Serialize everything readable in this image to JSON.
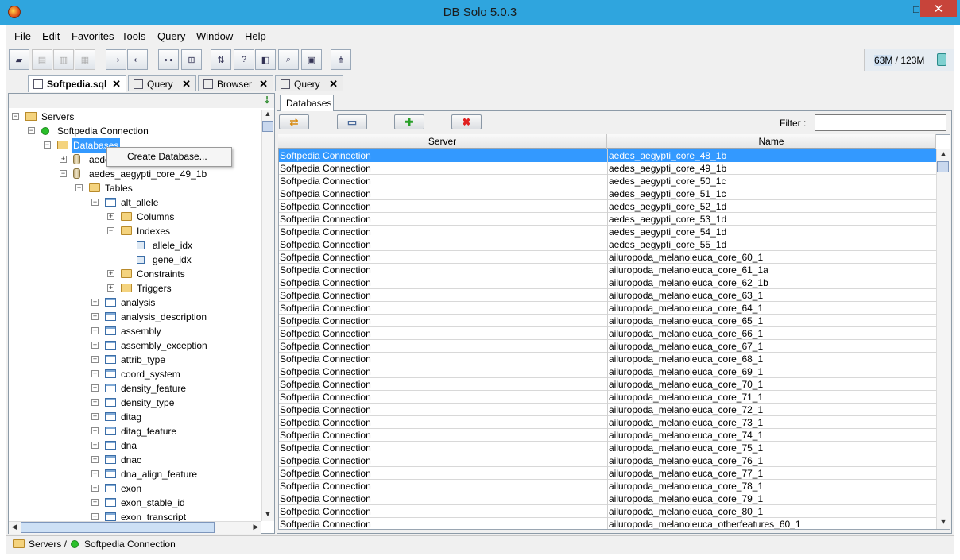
{
  "window": {
    "title": "DB Solo  5.0.3",
    "minimize": "–",
    "maximize": "□",
    "close": "✕"
  },
  "menu": [
    {
      "pre": "",
      "u": "F",
      "post": "ile"
    },
    {
      "pre": "",
      "u": "E",
      "post": "dit"
    },
    {
      "pre": "F",
      "u": "a",
      "post": "vorites"
    },
    {
      "pre": "",
      "u": "T",
      "post": "ools"
    },
    {
      "pre": "",
      "u": "Q",
      "post": "uery"
    },
    {
      "pre": "",
      "u": "W",
      "post": "indow"
    },
    {
      "pre": "",
      "u": "H",
      "post": "elp"
    }
  ],
  "toolbar": {
    "buttons": [
      "open-icon",
      "save-all-icon",
      "save-icon",
      "save-as-icon",
      "connect-icon",
      "disconnect-icon",
      "schema-browser-icon",
      "query-grid-icon",
      "compare-icon",
      "help-query-icon",
      "object-icon",
      "search-icon",
      "report-icon",
      "explain-icon"
    ],
    "memory": "63M / 123M",
    "memory_used": "63M",
    "memory_total": "123M"
  },
  "tabs": [
    {
      "label": "Softpedia.sql",
      "icon": "sql-file-icon",
      "active": true
    },
    {
      "label": "Query",
      "icon": "query-grid-icon",
      "active": false
    },
    {
      "label": "Browser",
      "icon": "browser-icon",
      "active": false
    },
    {
      "label": "Query",
      "icon": "query-grid-icon",
      "active": false
    }
  ],
  "tree": {
    "nodes": [
      {
        "label": "Servers",
        "depth": 0,
        "icon": "servers-icon",
        "expander": "−"
      },
      {
        "label": "Softpedia Connection",
        "depth": 1,
        "icon": "server-status-icon",
        "expander": "−"
      },
      {
        "label": "Databases",
        "depth": 2,
        "icon": "folder-open-icon",
        "expander": "−",
        "selected": true
      },
      {
        "label": "aedes_aegypti_core_48_1b",
        "depth": 3,
        "icon": "database-icon",
        "expander": "+"
      },
      {
        "label": "aedes_aegypti_core_49_1b",
        "depth": 3,
        "icon": "database-icon",
        "expander": "−"
      },
      {
        "label": "Tables",
        "depth": 4,
        "icon": "folder-open-icon",
        "expander": "−"
      },
      {
        "label": "alt_allele",
        "depth": 5,
        "icon": "table-icon",
        "expander": "−"
      },
      {
        "label": "Columns",
        "depth": 6,
        "icon": "folder-icon",
        "expander": "+"
      },
      {
        "label": "Indexes",
        "depth": 6,
        "icon": "folder-open-icon",
        "expander": "−"
      },
      {
        "label": "allele_idx",
        "depth": 7,
        "icon": "index-icon",
        "expander": ""
      },
      {
        "label": "gene_idx",
        "depth": 7,
        "icon": "index-icon",
        "expander": ""
      },
      {
        "label": "Constraints",
        "depth": 6,
        "icon": "folder-icon",
        "expander": "+"
      },
      {
        "label": "Triggers",
        "depth": 6,
        "icon": "folder-icon",
        "expander": "+"
      },
      {
        "label": "analysis",
        "depth": 5,
        "icon": "table-icon",
        "expander": "+"
      },
      {
        "label": "analysis_description",
        "depth": 5,
        "icon": "table-icon",
        "expander": "+"
      },
      {
        "label": "assembly",
        "depth": 5,
        "icon": "table-icon",
        "expander": "+"
      },
      {
        "label": "assembly_exception",
        "depth": 5,
        "icon": "table-icon",
        "expander": "+"
      },
      {
        "label": "attrib_type",
        "depth": 5,
        "icon": "table-icon",
        "expander": "+"
      },
      {
        "label": "coord_system",
        "depth": 5,
        "icon": "table-icon",
        "expander": "+"
      },
      {
        "label": "density_feature",
        "depth": 5,
        "icon": "table-icon",
        "expander": "+"
      },
      {
        "label": "density_type",
        "depth": 5,
        "icon": "table-icon",
        "expander": "+"
      },
      {
        "label": "ditag",
        "depth": 5,
        "icon": "table-icon",
        "expander": "+"
      },
      {
        "label": "ditag_feature",
        "depth": 5,
        "icon": "table-icon",
        "expander": "+"
      },
      {
        "label": "dna",
        "depth": 5,
        "icon": "table-icon",
        "expander": "+"
      },
      {
        "label": "dnac",
        "depth": 5,
        "icon": "table-icon",
        "expander": "+"
      },
      {
        "label": "dna_align_feature",
        "depth": 5,
        "icon": "table-icon",
        "expander": "+"
      },
      {
        "label": "exon",
        "depth": 5,
        "icon": "table-icon",
        "expander": "+"
      },
      {
        "label": "exon_stable_id",
        "depth": 5,
        "icon": "table-icon",
        "expander": "+"
      },
      {
        "label": "exon_transcript",
        "depth": 5,
        "icon": "table-icon",
        "expander": "+"
      }
    ]
  },
  "context_menu": {
    "item": "Create Database..."
  },
  "databases_panel": {
    "tab_label": "Databases",
    "buttons": [
      "refresh-icon",
      "print-icon",
      "add-icon",
      "delete-icon"
    ],
    "filter_label": "Filter :",
    "filter_value": "",
    "columns": [
      "Server",
      "Name"
    ],
    "rows": [
      [
        "Softpedia Connection",
        "aedes_aegypti_core_48_1b"
      ],
      [
        "Softpedia Connection",
        "aedes_aegypti_core_49_1b"
      ],
      [
        "Softpedia Connection",
        "aedes_aegypti_core_50_1c"
      ],
      [
        "Softpedia Connection",
        "aedes_aegypti_core_51_1c"
      ],
      [
        "Softpedia Connection",
        "aedes_aegypti_core_52_1d"
      ],
      [
        "Softpedia Connection",
        "aedes_aegypti_core_53_1d"
      ],
      [
        "Softpedia Connection",
        "aedes_aegypti_core_54_1d"
      ],
      [
        "Softpedia Connection",
        "aedes_aegypti_core_55_1d"
      ],
      [
        "Softpedia Connection",
        "ailuropoda_melanoleuca_core_60_1"
      ],
      [
        "Softpedia Connection",
        "ailuropoda_melanoleuca_core_61_1a"
      ],
      [
        "Softpedia Connection",
        "ailuropoda_melanoleuca_core_62_1b"
      ],
      [
        "Softpedia Connection",
        "ailuropoda_melanoleuca_core_63_1"
      ],
      [
        "Softpedia Connection",
        "ailuropoda_melanoleuca_core_64_1"
      ],
      [
        "Softpedia Connection",
        "ailuropoda_melanoleuca_core_65_1"
      ],
      [
        "Softpedia Connection",
        "ailuropoda_melanoleuca_core_66_1"
      ],
      [
        "Softpedia Connection",
        "ailuropoda_melanoleuca_core_67_1"
      ],
      [
        "Softpedia Connection",
        "ailuropoda_melanoleuca_core_68_1"
      ],
      [
        "Softpedia Connection",
        "ailuropoda_melanoleuca_core_69_1"
      ],
      [
        "Softpedia Connection",
        "ailuropoda_melanoleuca_core_70_1"
      ],
      [
        "Softpedia Connection",
        "ailuropoda_melanoleuca_core_71_1"
      ],
      [
        "Softpedia Connection",
        "ailuropoda_melanoleuca_core_72_1"
      ],
      [
        "Softpedia Connection",
        "ailuropoda_melanoleuca_core_73_1"
      ],
      [
        "Softpedia Connection",
        "ailuropoda_melanoleuca_core_74_1"
      ],
      [
        "Softpedia Connection",
        "ailuropoda_melanoleuca_core_75_1"
      ],
      [
        "Softpedia Connection",
        "ailuropoda_melanoleuca_core_76_1"
      ],
      [
        "Softpedia Connection",
        "ailuropoda_melanoleuca_core_77_1"
      ],
      [
        "Softpedia Connection",
        "ailuropoda_melanoleuca_core_78_1"
      ],
      [
        "Softpedia Connection",
        "ailuropoda_melanoleuca_core_79_1"
      ],
      [
        "Softpedia Connection",
        "ailuropoda_melanoleuca_core_80_1"
      ],
      [
        "Softpedia Connection",
        "ailuropoda_melanoleuca_otherfeatures_60_1"
      ]
    ],
    "selected_row": 0
  },
  "statusbar": {
    "servers": "Servers /",
    "connection": "Softpedia Connection"
  },
  "colors": {
    "titlebar": "#2fa5de",
    "selection": "#3399ff",
    "close": "#c7443a",
    "server_ok": "#2bbf2b"
  }
}
